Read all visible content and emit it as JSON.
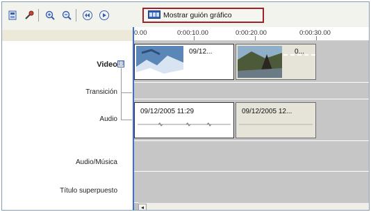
{
  "toolbar": {
    "icons": [
      "storyboard-view-icon",
      "tools-icon",
      "zoom-in-icon",
      "zoom-out-icon",
      "rewind-icon",
      "play-icon",
      "film-storyboard-icon"
    ],
    "storyboard_button_label": "Mostrar guión gráfico"
  },
  "ruler": {
    "ticks": [
      "0.00",
      "0:00:10.00",
      "0:00:20.00",
      "0:00:30.00"
    ]
  },
  "tracks": {
    "video": "Video",
    "transition": "Transición",
    "audio": "Audio",
    "audio_music": "Audio/Música",
    "title_overlay": "Título superpuesto",
    "expand_symbol": "⊟"
  },
  "video_clips": [
    {
      "title": "09/12..."
    },
    {
      "title": "0..."
    }
  ],
  "audio_clips": [
    {
      "title": "09/12/2005 11:29"
    },
    {
      "title": "09/12/2005 12..."
    }
  ],
  "colors": {
    "accent_border": "#a0202a",
    "playhead": "#3a6fd8",
    "lane_bg": "#c6c6c6"
  }
}
